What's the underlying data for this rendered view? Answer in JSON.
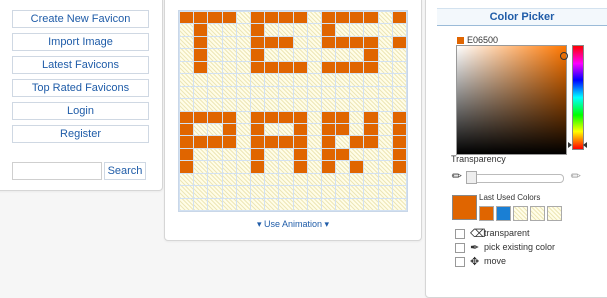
{
  "nav": {
    "items": [
      "Create New Favicon",
      "Import Image",
      "Latest Favicons",
      "Top Rated Favicons",
      "Login",
      "Register"
    ],
    "search_label": "Search"
  },
  "editor": {
    "pixel_color": "#E06500",
    "grid": [
      "1111011110111101",
      "0100010000100000",
      "0100011100111101",
      "0100010000000100",
      "0100011110111100",
      "0000000000000000",
      "0000000000000000",
      "0000000000000000",
      "1111011110110101",
      "1001010010110101",
      "1111011110101101",
      "1000010010110001",
      "1000010010101001",
      "0000000000000000",
      "0000000000000000",
      "0000000000000000"
    ],
    "animation_link": "Use Animation"
  },
  "color_picker": {
    "title": "Color Picker",
    "hex": "E06500",
    "color": "#E06500",
    "hue_color": "#ff7700",
    "transparency_label": "Transparency",
    "last_used_label": "Last Used Colors",
    "recent_colors": [
      "#E06500",
      "#1a7fd4",
      "transparent",
      "transparent",
      "transparent"
    ],
    "options": {
      "transparent": "transparent",
      "pick_existing": "pick existing color",
      "move": "move"
    }
  }
}
